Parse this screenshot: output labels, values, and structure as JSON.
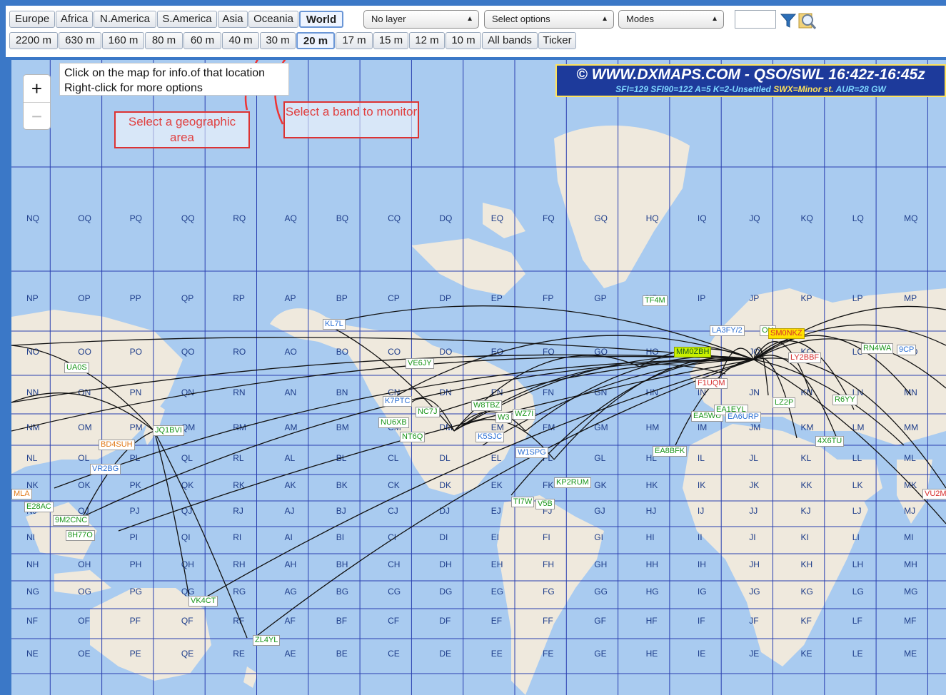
{
  "regions": [
    "Europe",
    "Africa",
    "N.America",
    "S.America",
    "Asia",
    "Oceania",
    "World"
  ],
  "active_region": "World",
  "bands": [
    "2200 m",
    "630 m",
    "160 m",
    "80 m",
    "60 m",
    "40 m",
    "30 m",
    "20 m",
    "17 m",
    "15 m",
    "12 m",
    "10 m",
    "All bands",
    "Ticker"
  ],
  "active_band": "20 m",
  "selects": {
    "layer": "No layer",
    "options": "Select options",
    "modes": "Modes"
  },
  "filter_input": {
    "value": ""
  },
  "icons": {
    "filter": "filter-funnel-icon",
    "zoom": "zoom-magnifier-icon"
  },
  "map": {
    "zoom_in": "+",
    "zoom_out": "−",
    "info_line1": "Click on the map for info.of that location",
    "info_line2": "Right-click for more options",
    "callout_area": "Select a geographic area",
    "callout_band": "Select a band to monitor",
    "banner_line1_copy": "© WWW.DXMAPS.COM",
    "banner_line1_rest": " - QSO/SWL 16:42z-16:45z",
    "banner_line2": {
      "sfi": "SFI=129",
      "sfi90": "SFI90=122",
      "a": "A=5",
      "k": "K=2-Unsettled",
      "swx": "SWX=Minor st.",
      "aur": "AUR=28 GW"
    }
  },
  "grid": {
    "columns": [
      "NQ",
      "OQ",
      "PQ",
      "QQ",
      "RQ",
      "AQ",
      "BQ",
      "CQ",
      "DQ",
      "EQ",
      "FQ",
      "GQ",
      "HQ",
      "IQ",
      "JQ",
      "KQ",
      "LQ",
      "MQ"
    ],
    "col_letters": [
      "N",
      "O",
      "P",
      "Q",
      "R",
      "A",
      "B",
      "C",
      "D",
      "E",
      "F",
      "G",
      "H",
      "I",
      "J",
      "K",
      "L",
      "M"
    ],
    "row_letters": [
      "Q",
      "P",
      "O",
      "N",
      "M",
      "L",
      "K",
      "J",
      "I",
      "H",
      "G",
      "F",
      "E"
    ]
  },
  "stations": [
    {
      "call": "UA0S",
      "style": "green"
    },
    {
      "call": "JQ1BVI",
      "style": "green"
    },
    {
      "call": "BD4SUH",
      "style": "orange"
    },
    {
      "call": "VR2BG",
      "style": "blue"
    },
    {
      "call": "E28AC",
      "style": "green"
    },
    {
      "call": "9M2CNC",
      "style": "green"
    },
    {
      "call": "8H77O",
      "style": "green"
    },
    {
      "call": "MLA",
      "style": "orange"
    },
    {
      "call": "VK4CT",
      "style": "green"
    },
    {
      "call": "ZL4YL",
      "style": "green"
    },
    {
      "call": "KL7L",
      "style": "blue"
    },
    {
      "call": "VE6JY",
      "style": "green"
    },
    {
      "call": "K7PTC",
      "style": "blue"
    },
    {
      "call": "NC7J",
      "style": "green"
    },
    {
      "call": "NU6XB",
      "style": "green"
    },
    {
      "call": "NT6Q",
      "style": "green"
    },
    {
      "call": "W8TBZ",
      "style": "green"
    },
    {
      "call": "W3",
      "style": "green"
    },
    {
      "call": "WZ7I",
      "style": "green"
    },
    {
      "call": "K5SJC",
      "style": "blue"
    },
    {
      "call": "W1SPG",
      "style": "blue"
    },
    {
      "call": "KP2RUM",
      "style": "green"
    },
    {
      "call": "TI7W",
      "style": "green"
    },
    {
      "call": "V5B",
      "style": "green"
    },
    {
      "call": "TF4M",
      "style": "green"
    },
    {
      "call": "MM0ZBH",
      "style": "lime"
    },
    {
      "call": "LA3FY/2",
      "style": "blue"
    },
    {
      "call": "OH",
      "style": "green"
    },
    {
      "call": "SM0NKZ",
      "style": "ylw"
    },
    {
      "call": "LY2BBF",
      "style": "red"
    },
    {
      "call": "RN4WA",
      "style": "green"
    },
    {
      "call": "9CP",
      "style": "blue"
    },
    {
      "call": "F1UQM",
      "style": "red"
    },
    {
      "call": "EA5WU",
      "style": "green"
    },
    {
      "call": "EA1EYL",
      "style": "green"
    },
    {
      "call": "EA6URP",
      "style": "blue"
    },
    {
      "call": "LZ2P",
      "style": "green"
    },
    {
      "call": "R6YY",
      "style": "green"
    },
    {
      "call": "4X6TU",
      "style": "green"
    },
    {
      "call": "EA8BFK",
      "style": "green"
    },
    {
      "call": "VU2M",
      "style": "red"
    }
  ]
}
